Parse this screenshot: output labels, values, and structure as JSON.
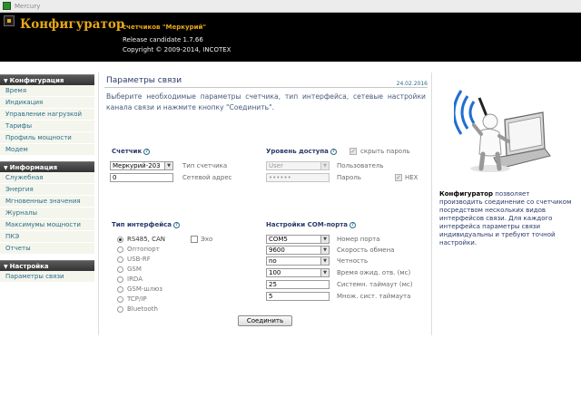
{
  "window": {
    "title": "Mercury"
  },
  "header": {
    "brand": "Конфигуратор",
    "subtitle": "счетчиков \"Меркурий\"",
    "version": "Release candidate 1.7.66",
    "copyright": "Copyright © 2009-2014, INCOTEX"
  },
  "sidebar": {
    "sections": [
      {
        "title": "Конфигурация",
        "items": [
          "Время",
          "Индикация",
          "Управление нагрузкой",
          "Тарифы",
          "Профиль мощности",
          "Модем"
        ]
      },
      {
        "title": "Информация",
        "items": [
          "Служебная",
          "Энергия",
          "Мгновенные значения",
          "Журналы",
          "Максимумы мощности",
          "ПКЭ",
          "Отчеты"
        ]
      },
      {
        "title": "Настройка",
        "items": [
          "Параметры связи"
        ]
      }
    ]
  },
  "page": {
    "title": "Параметры связи",
    "date": "24.02.2016",
    "intro": "Выберите необходимые параметры счетчика, тип интерфейса, сетевые настройки канала связи и нажмите кнопку \"Соединить\"."
  },
  "meter": {
    "section_label": "Счетчик",
    "type_value": "Меркурий-203",
    "type_label": "Тип счетчика",
    "address_value": "0",
    "address_label": "Сетевой адрес"
  },
  "access": {
    "section_label": "Уровень доступа",
    "hide_password_label": "скрыть пароль",
    "hide_password_checked": true,
    "user_value": "User",
    "user_label": "Пользователь",
    "password_value": "••••••",
    "password_label": "Пароль",
    "hex_label": "HEX",
    "hex_checked": true
  },
  "interface": {
    "section_label": "Тип интерфейса",
    "echo_label": "Эхо",
    "options": [
      {
        "label": "RS485, CAN",
        "selected": true
      },
      {
        "label": "Оптопорт",
        "selected": false
      },
      {
        "label": "USB-RF",
        "selected": false
      },
      {
        "label": "GSM",
        "selected": false
      },
      {
        "label": "IRDA",
        "selected": false
      },
      {
        "label": "GSM-шлюз",
        "selected": false
      },
      {
        "label": "TCP/IP",
        "selected": false
      },
      {
        "label": "Bluetooth",
        "selected": false
      }
    ]
  },
  "com": {
    "section_label": "Настройки COM-порта",
    "rows": [
      {
        "value": "COM5",
        "label": "Номер порта"
      },
      {
        "value": "9600",
        "label": "Скорость обмена"
      },
      {
        "value": "no",
        "label": "Четность"
      },
      {
        "value": "100",
        "label": "Время ожид. отв. (мс)"
      },
      {
        "value": "25",
        "label": "Системн. таймаут (мс)"
      },
      {
        "value": "5",
        "label": "Множ. сист. таймаута"
      }
    ]
  },
  "actions": {
    "connect_label": "Соединить"
  },
  "info": {
    "brand_word": "Конфигуратор",
    "text": " позволяет производить соединение со счетчиком посредством нескольких видов интерфейсов связи. Для каждого интерфейса параметры связи индивидуальны и требуют точной настройки."
  },
  "icons": {
    "app": "app-icon",
    "help": "help-icon",
    "illustration": "connection-illustration-icon"
  },
  "colors": {
    "header_bg": "#000000",
    "brand": "#e6a817",
    "accent_text": "#2a3a6a",
    "nav_link": "#2a6e8a"
  }
}
